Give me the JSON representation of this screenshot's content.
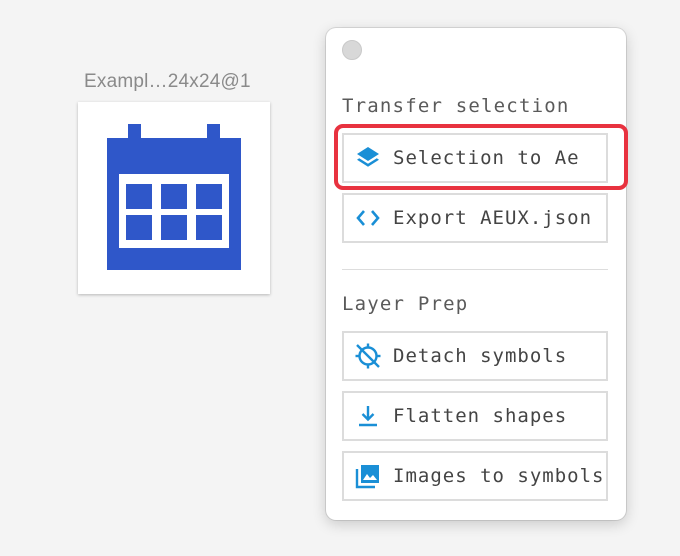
{
  "artboard": {
    "label": "Exampl…24x24@1",
    "icon": "calendar-icon",
    "icon_color": "#2f57c9"
  },
  "panel": {
    "sections": [
      {
        "title": "Transfer selection",
        "buttons": [
          {
            "label": "Selection to Ae",
            "icon": "layers-icon"
          },
          {
            "label": "Export AEUX.json",
            "icon": "code-brackets-icon"
          }
        ]
      },
      {
        "title": "Layer Prep",
        "buttons": [
          {
            "label": "Detach symbols",
            "icon": "detach-crosshair-icon"
          },
          {
            "label": "Flatten shapes",
            "icon": "download-arrow-icon"
          },
          {
            "label": "Images to symbols",
            "icon": "image-stack-icon"
          }
        ]
      }
    ],
    "accent_color": "#1a8fd6",
    "highlight_color": "#e8323f"
  }
}
